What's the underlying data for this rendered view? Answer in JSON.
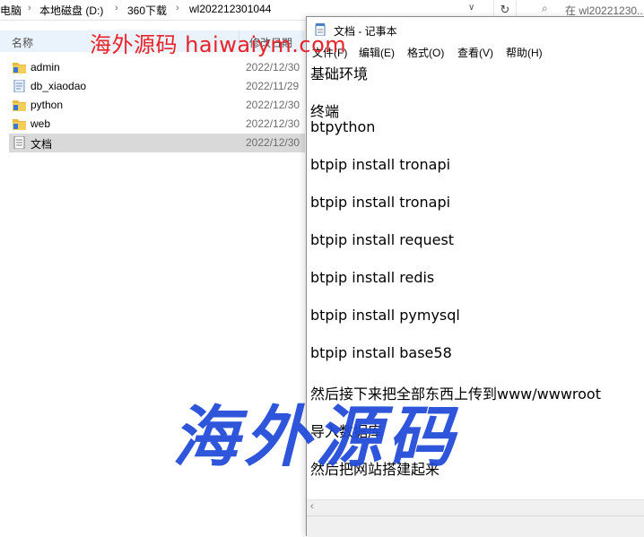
{
  "explorer": {
    "breadcrumbs": [
      "电脑",
      "本地磁盘 (D:)",
      "360下载",
      "wl202212301044"
    ],
    "search_placeholder": "在 wl20221230...",
    "columns": {
      "name": "名称",
      "date": "修改日期"
    },
    "files": [
      {
        "name": "admin",
        "date": "2022/12/30",
        "icon": "folder-icon"
      },
      {
        "name": "db_xiaodao",
        "date": "2022/11/29",
        "icon": "sql-file-icon"
      },
      {
        "name": "python",
        "date": "2022/12/30",
        "icon": "folder-icon"
      },
      {
        "name": "web",
        "date": "2022/12/30",
        "icon": "folder-icon"
      },
      {
        "name": "文档",
        "date": "2022/12/30",
        "icon": "text-file-icon",
        "selected": true
      }
    ]
  },
  "watermark": {
    "top": "海外源码 haiwaiym.com",
    "big": "海外源码"
  },
  "notepad": {
    "title": "文档 - 记事本",
    "menu": [
      "文件(F)",
      "编辑(E)",
      "格式(O)",
      "查看(V)",
      "帮助(H)"
    ],
    "lines": [
      "基础环境",
      "终端",
      "btpython",
      "btpip install tronapi",
      "btpip install tronapi",
      "btpip install request",
      "btpip install redis",
      "btpip install pymysql",
      "btpip install base58",
      "然后接下来把全部东西上传到www/wwwroot",
      "导入数据库",
      "然后把网站搭建起来"
    ]
  },
  "colors": {
    "folder": "#e8b93c",
    "selected_row": "#d9d9d9",
    "header_bg": "#eaf2fb",
    "watermark_red": "#e8232a",
    "watermark_blue": "#1f49d8"
  }
}
